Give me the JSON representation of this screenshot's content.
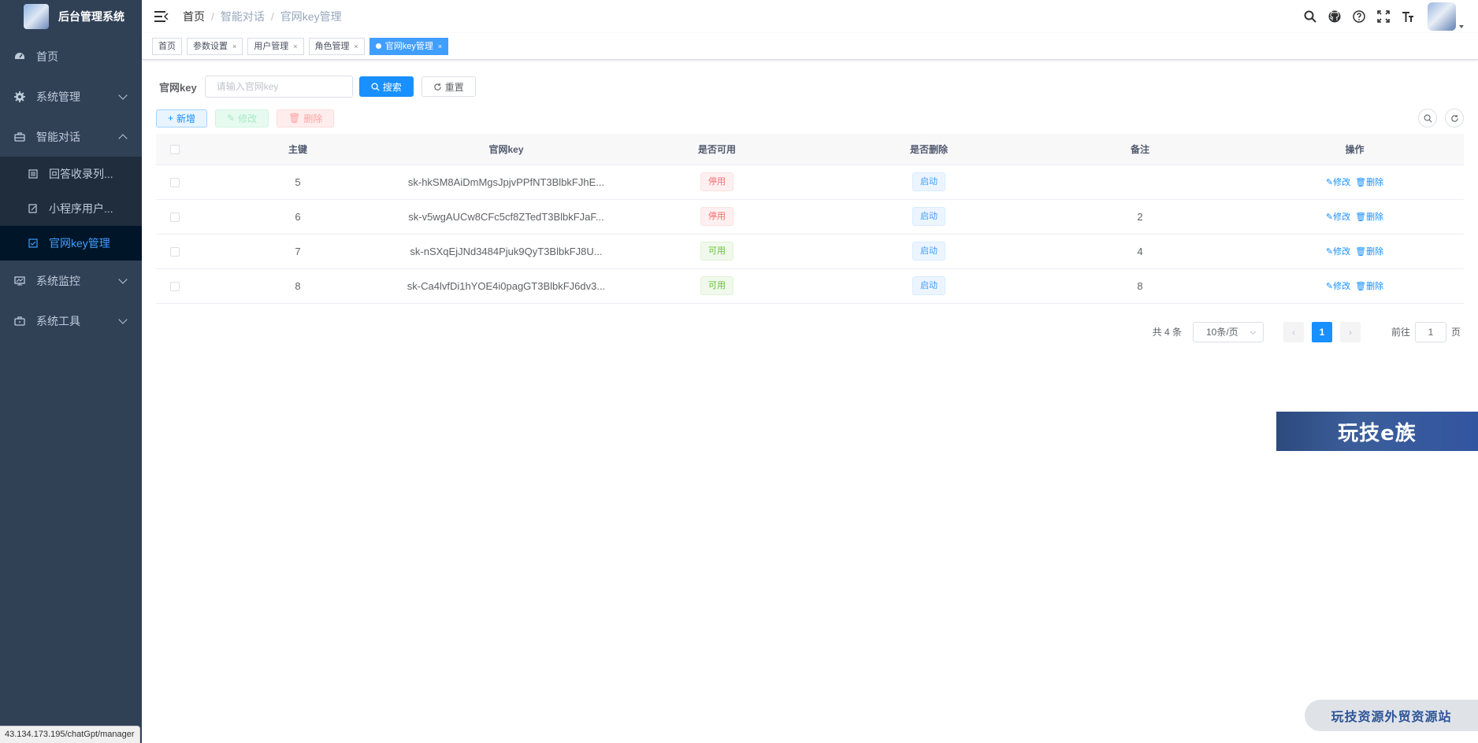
{
  "app": {
    "title": "后台管理系统"
  },
  "sidebar": {
    "items": [
      {
        "label": "首页",
        "icon": "dashboard-icon"
      },
      {
        "label": "系统管理",
        "icon": "gear-icon",
        "expandable": true
      },
      {
        "label": "智能对话",
        "icon": "briefcase-icon",
        "expandable": true,
        "expanded": true,
        "children": [
          {
            "label": "回答收录列...",
            "icon": "list-icon"
          },
          {
            "label": "小程序用户...",
            "icon": "edit-doc-icon"
          },
          {
            "label": "官网key管理",
            "icon": "checkbox-icon",
            "active": true
          }
        ]
      },
      {
        "label": "系统监控",
        "icon": "monitor-icon",
        "expandable": true
      },
      {
        "label": "系统工具",
        "icon": "toolbox-icon",
        "expandable": true
      }
    ]
  },
  "breadcrumb": [
    "首页",
    "智能对话",
    "官网key管理"
  ],
  "tags": [
    {
      "label": "首页",
      "closable": false
    },
    {
      "label": "参数设置",
      "closable": true
    },
    {
      "label": "用户管理",
      "closable": true
    },
    {
      "label": "角色管理",
      "closable": true
    },
    {
      "label": "官网key管理",
      "closable": true,
      "active": true
    }
  ],
  "tag_close": "×",
  "search": {
    "label": "官网key",
    "placeholder": "请输入官网key",
    "search_btn": "搜索",
    "reset_btn": "重置"
  },
  "toolbar": {
    "add": "新增",
    "edit": "修改",
    "delete": "删除"
  },
  "table": {
    "headers": [
      "主键",
      "官网key",
      "是否可用",
      "是否删除",
      "备注",
      "操作"
    ],
    "rows": [
      {
        "id": "5",
        "key": "sk-hkSM8AiDmMgsJpjvPPfNT3BlbkFJhE...",
        "available": "停用",
        "available_type": "danger",
        "deleted": "启动",
        "remark": ""
      },
      {
        "id": "6",
        "key": "sk-v5wgAUCw8CFc5cf8ZTedT3BlbkFJaF...",
        "available": "停用",
        "available_type": "danger",
        "deleted": "启动",
        "remark": "2"
      },
      {
        "id": "7",
        "key": "sk-nSXqEjJNd3484Pjuk9QyT3BlbkFJ8U...",
        "available": "可用",
        "available_type": "success",
        "deleted": "启动",
        "remark": "4"
      },
      {
        "id": "8",
        "key": "sk-Ca4lvfDi1hYOE4i0pagGT3BlbkFJ6dv3...",
        "available": "可用",
        "available_type": "success",
        "deleted": "启动",
        "remark": "8"
      }
    ],
    "op_edit": "修改",
    "op_delete": "删除"
  },
  "pagination": {
    "total": "共 4 条",
    "page_size": "10条/页",
    "current": "1",
    "goto_prefix": "前往",
    "goto_value": "1",
    "goto_suffix": "页"
  },
  "watermarks": {
    "banner": "玩技e族",
    "footer": "玩技资源外贸资源站"
  },
  "status_url": "43.134.173.195/chatGpt/manager"
}
